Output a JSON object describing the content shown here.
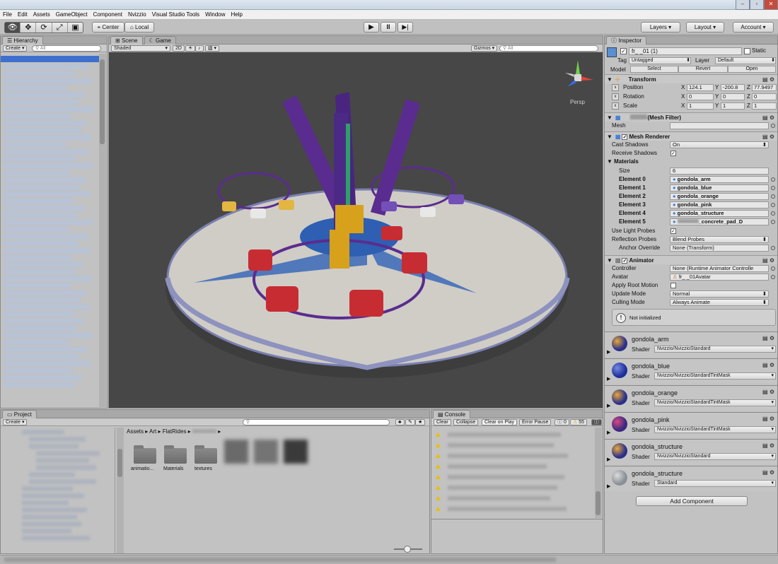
{
  "menu": [
    "File",
    "Edit",
    "Assets",
    "GameObject",
    "Component",
    "Nvizzio",
    "Visual Studio Tools",
    "Window",
    "Help"
  ],
  "toolbar": {
    "pivot": "Center",
    "space": "Local",
    "layers": "Layers",
    "layout": "Layout",
    "account": "Account"
  },
  "hierarchy": {
    "tab": "Hierarchy",
    "create": "Create",
    "search": "All"
  },
  "scene": {
    "tab_scene": "Scene",
    "tab_game": "Game",
    "shading": "Shaded",
    "mode_2d": "2D",
    "gizmos": "Gizmos",
    "search": "All",
    "persp": "Persp"
  },
  "inspector": {
    "tab": "Inspector",
    "object_name": "fr_      _01 (1)",
    "static": "Static",
    "tag_label": "Tag",
    "tag_value": "Untagged",
    "layer_label": "Layer",
    "layer_value": "Default",
    "model_label": "Model",
    "model_select": "Select",
    "model_revert": "Revert",
    "model_open": "Open",
    "transform": {
      "title": "Transform",
      "position_label": "Position",
      "pos_x": "124.1",
      "pos_y": "-200.8",
      "pos_z": "77.9497",
      "rotation_label": "Rotation",
      "rot_x": "0",
      "rot_y": "0",
      "rot_z": "0",
      "scale_label": "Scale",
      "sc_x": "1",
      "sc_y": "1",
      "sc_z": "1"
    },
    "mesh_filter": {
      "title": "(Mesh Filter)",
      "mesh_label": "Mesh"
    },
    "mesh_renderer": {
      "title": "Mesh Renderer",
      "cast_shadows_label": "Cast Shadows",
      "cast_shadows_value": "On",
      "receive_shadows_label": "Receive Shadows",
      "materials_label": "Materials",
      "size_label": "Size",
      "size_value": "6",
      "elements": [
        {
          "label": "Element 0",
          "value": "gondola_arm"
        },
        {
          "label": "Element 1",
          "value": "gondola_blue"
        },
        {
          "label": "Element 2",
          "value": "gondola_orange"
        },
        {
          "label": "Element 3",
          "value": "gondola_pink"
        },
        {
          "label": "Element 4",
          "value": "gondola_structure"
        },
        {
          "label": "Element 5",
          "value": "_concrete_pad_D"
        }
      ],
      "use_light_probes_label": "Use Light Probes",
      "reflection_probes_label": "Reflection Probes",
      "reflection_probes_value": "Blend Probes",
      "anchor_override_label": "Anchor Override",
      "anchor_override_value": "None (Transform)"
    },
    "animator": {
      "title": "Animator",
      "controller_label": "Controller",
      "controller_value": "None (Runtime Animator Controlle",
      "avatar_label": "Avatar",
      "avatar_value": "fr_      _01Avatar",
      "apply_root_motion_label": "Apply Root Motion",
      "update_mode_label": "Update Mode",
      "update_mode_value": "Normal",
      "culling_mode_label": "Culling Mode",
      "culling_mode_value": "Always Animate",
      "notice": "Not initialized"
    },
    "shader_label": "Shader",
    "materials": [
      {
        "name": "gondola_arm",
        "shader": "Nvizzio/NvizzioStandard",
        "color": "#2a2f8a"
      },
      {
        "name": "gondola_blue",
        "shader": "Nvizzio/NvizzioStandardTintMask",
        "color": "#1d2f9a"
      },
      {
        "name": "gondola_orange",
        "shader": "Nvizzio/NvizzioStandardTintMask",
        "color": "#2a2f8a"
      },
      {
        "name": "gondola_pink",
        "shader": "Nvizzio/NvizzioStandardTintMask",
        "color": "#3a2880"
      },
      {
        "name": "gondola_structure",
        "shader": "Nvizzio/NvizzioStandard",
        "color": "#2a2f8a"
      },
      {
        "name": "gondola_structure",
        "shader": "Standard",
        "color": "#8a9096"
      }
    ],
    "add_component": "Add Component"
  },
  "project": {
    "tab": "Project",
    "create": "Create",
    "breadcrumb": [
      "Assets",
      "Art",
      "FlatRides"
    ],
    "folders": [
      "animatio...",
      "Materials",
      "textures"
    ]
  },
  "console": {
    "tab": "Console",
    "clear": "Clear",
    "collapse": "Collapse",
    "clear_on_play": "Clear on Play",
    "error_pause": "Error Pause",
    "errors": "0",
    "warnings": "55"
  }
}
